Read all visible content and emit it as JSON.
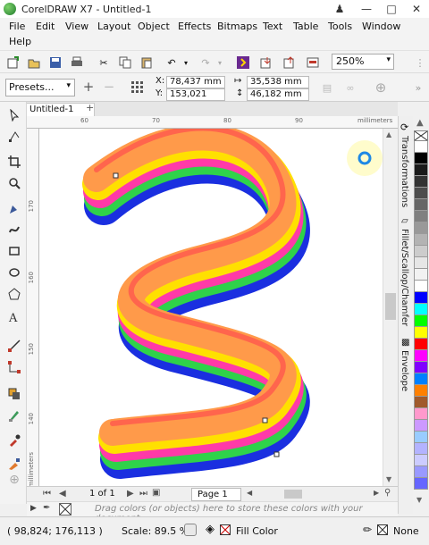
{
  "app": {
    "title": "CorelDRAW X7 - Untitled-1"
  },
  "menu": [
    "File",
    "Edit",
    "View",
    "Layout",
    "Object",
    "Effects",
    "Bitmaps",
    "Text",
    "Table",
    "Tools",
    "Window",
    "Help"
  ],
  "toolbar": {
    "zoom": "250%"
  },
  "property_bar": {
    "presets": "Presets...",
    "x_label": "X:",
    "x_value": "78,437 mm",
    "y_label": "Y:",
    "y_value": "153,021 mm",
    "w_value": "35,538 mm",
    "h_value": "46,182 mm"
  },
  "document_tab": "Untitled-1",
  "ruler": {
    "h_ticks": [
      "60",
      "70",
      "80",
      "90"
    ],
    "h_unit": "millimeters",
    "v_ticks": [
      "170",
      "160",
      "150",
      "140"
    ],
    "v_unit": "millimeters"
  },
  "dockers": [
    "Transformations",
    "Fillet/Scallop/Chamfer",
    "Envelope"
  ],
  "palette_colors": [
    "#ffffff",
    "#000000",
    "#1a1a1a",
    "#333333",
    "#4d4d4d",
    "#666666",
    "#808080",
    "#999999",
    "#b3b3b3",
    "#cccccc",
    "#e6e6e6",
    "#f2f2f2",
    "#ffffff",
    "#0000ff",
    "#00ffff",
    "#00ff00",
    "#ffff00",
    "#ff0000",
    "#ff00ff",
    "#8000ff",
    "#0080ff",
    "#ff8000",
    "#a05a2c",
    "#ff99cc",
    "#cc99ff",
    "#99ccff",
    "#b3b3ff",
    "#ccccff",
    "#9999ff",
    "#6666ff"
  ],
  "page_nav": {
    "count": "1 of 1",
    "tab": "Page 1"
  },
  "doc_palette": {
    "hint": "Drag colors (or objects) here to store these colors with your document"
  },
  "status": {
    "coords": "( 98,824; 176,113 )",
    "scale": "Scale: 89.5 %",
    "fill": "Fill Color",
    "outline": "None"
  }
}
